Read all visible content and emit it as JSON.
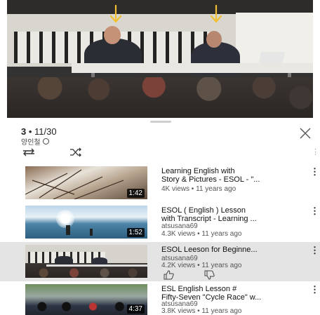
{
  "player": {
    "arrow_color": "#f0c030"
  },
  "playlist": {
    "position_current": "3",
    "position_rest": " • 11/30",
    "channel": "양인철",
    "icons": {
      "close": "close-icon",
      "loop": "loop-icon",
      "shuffle": "shuffle-icon",
      "more": "more-vert-icon",
      "globe": "globe-icon"
    }
  },
  "items": [
    {
      "title_line1": "Learning English with",
      "title_line2": "Story & Pictures - ESOL - \"...",
      "channel": "",
      "meta": "4K views • 11 years ago",
      "duration": "1:42"
    },
    {
      "title_line1": "ESOL ( English ) Lesson",
      "title_line2": "with Transcript - Learning ...",
      "channel": "atsusana69",
      "meta": "4.3K views • 11 years ago",
      "duration": "1:52"
    },
    {
      "title_line1": "ESOL Leeson  for Beginne...",
      "title_line2": "",
      "channel": "atsusana69",
      "meta": "4.2K views • 11 years ago",
      "duration": "",
      "active": true
    },
    {
      "title_line1": "ESL English Lesson #",
      "title_line2": "Fifty-Seven \"Cycle Race\" w...",
      "channel": "atsusana69",
      "meta": "3.8K views • 11 years ago",
      "duration": "4:37"
    }
  ],
  "active_item_icons": [
    "thumbs-up-icon",
    "thumbs-down-icon"
  ]
}
